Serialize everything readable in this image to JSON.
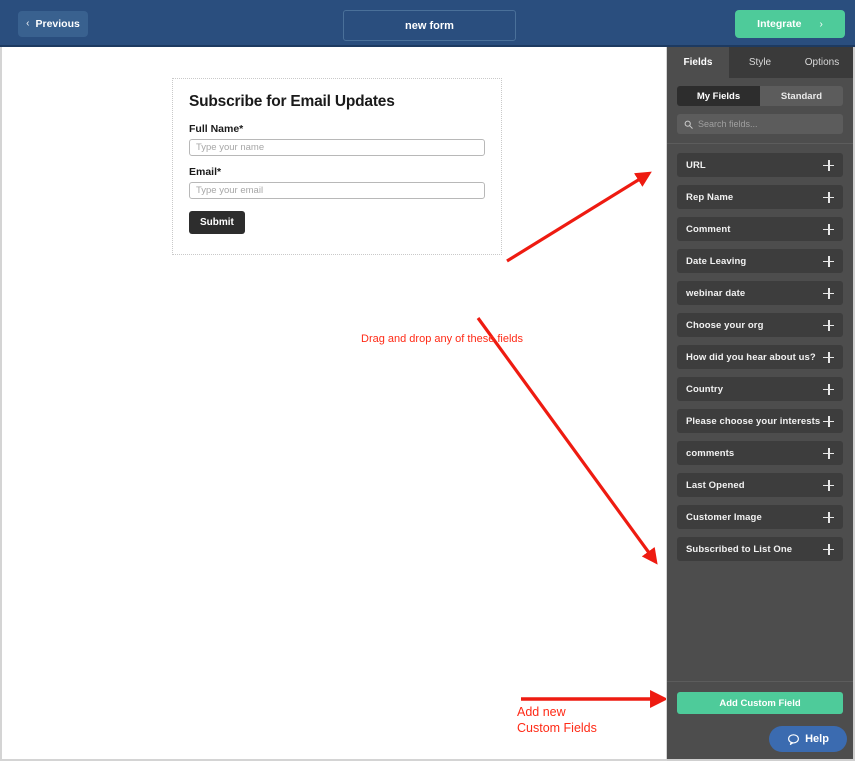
{
  "topbar": {
    "previous_label": "Previous",
    "previous_chevron": "‹",
    "form_name": "new form",
    "integrate_label": "Integrate",
    "integrate_chevron": "›",
    "bg_color": "#2a4e7e",
    "accent_color": "#4ecb9a"
  },
  "form": {
    "heading": "Subscribe for Email Updates",
    "fields": [
      {
        "label": "Full Name*",
        "placeholder": "Type your name",
        "value": ""
      },
      {
        "label": "Email*",
        "placeholder": "Type your email",
        "value": ""
      }
    ],
    "submit_label": "Submit"
  },
  "annotations": [
    {
      "name": "drag-drop-note",
      "text": "Drag and drop any of these fields",
      "color": "#ff2a16"
    },
    {
      "name": "add-new-custom-fields-note",
      "text": "Add new\nCustom Fields",
      "color": "#ff2a16"
    }
  ],
  "sidebar": {
    "tabs": [
      {
        "label": "Fields",
        "active": true
      },
      {
        "label": "Style",
        "active": false
      },
      {
        "label": "Options",
        "active": false
      }
    ],
    "segmented": [
      {
        "label": "My Fields",
        "active": true
      },
      {
        "label": "Standard",
        "active": false
      }
    ],
    "search": {
      "placeholder": "Search fields...",
      "value": "",
      "icon": "search-icon"
    },
    "field_items": [
      {
        "label": "URL",
        "action_icon": "plus-icon"
      },
      {
        "label": "Rep Name",
        "action_icon": "plus-icon"
      },
      {
        "label": "Comment",
        "action_icon": "plus-icon"
      },
      {
        "label": "Date Leaving",
        "action_icon": "plus-icon"
      },
      {
        "label": "webinar date",
        "action_icon": "plus-icon"
      },
      {
        "label": "Choose your org",
        "action_icon": "plus-icon"
      },
      {
        "label": "How did you hear about us?",
        "action_icon": "plus-icon"
      },
      {
        "label": "Country",
        "action_icon": "plus-icon"
      },
      {
        "label": "Please choose your interests",
        "action_icon": "plus-icon"
      },
      {
        "label": "comments",
        "action_icon": "plus-icon"
      },
      {
        "label": "Last Opened",
        "action_icon": "plus-icon"
      },
      {
        "label": "Customer Image",
        "action_icon": "plus-icon"
      },
      {
        "label": "Subscribed to List One",
        "action_icon": "plus-icon"
      }
    ],
    "add_custom_field_label": "Add Custom Field",
    "help_label": "Help",
    "bg_color": "#4d4d4d",
    "item_color": "#3d3d3d",
    "help_color": "#3b6bb0"
  }
}
